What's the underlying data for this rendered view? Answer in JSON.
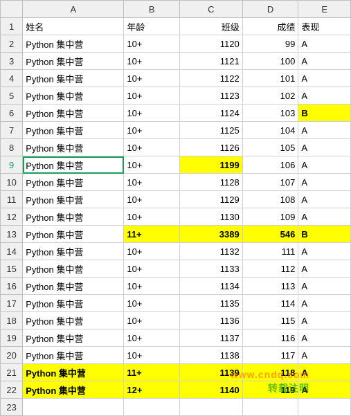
{
  "columns": {
    "rowhdr": "",
    "letters": [
      "A",
      "B",
      "C",
      "D",
      "E"
    ]
  },
  "header_row": {
    "num": "1",
    "cells": [
      "姓名",
      "年龄",
      "班级",
      "成绩",
      "表现"
    ]
  },
  "selected": {
    "row_index": 9,
    "col_index": 0
  },
  "rows": [
    {
      "num": "2",
      "a": "Python 集中营",
      "b": "10+",
      "c": "1120",
      "d": "99",
      "e": "A",
      "hl": {}
    },
    {
      "num": "3",
      "a": "Python 集中营",
      "b": "10+",
      "c": "1121",
      "d": "100",
      "e": "A",
      "hl": {}
    },
    {
      "num": "4",
      "a": "Python 集中营",
      "b": "10+",
      "c": "1122",
      "d": "101",
      "e": "A",
      "hl": {}
    },
    {
      "num": "5",
      "a": "Python 集中营",
      "b": "10+",
      "c": "1123",
      "d": "102",
      "e": "A",
      "hl": {}
    },
    {
      "num": "6",
      "a": "Python 集中营",
      "b": "10+",
      "c": "1124",
      "d": "103",
      "e": "B",
      "hl": {
        "e": true
      }
    },
    {
      "num": "7",
      "a": "Python 集中营",
      "b": "10+",
      "c": "1125",
      "d": "104",
      "e": "A",
      "hl": {}
    },
    {
      "num": "8",
      "a": "Python 集中营",
      "b": "10+",
      "c": "1126",
      "d": "105",
      "e": "A",
      "hl": {}
    },
    {
      "num": "9",
      "a": "Python 集中营",
      "b": "10+",
      "c": "1199",
      "d": "106",
      "e": "A",
      "hl": {
        "c": true
      }
    },
    {
      "num": "10",
      "a": "Python 集中营",
      "b": "10+",
      "c": "1128",
      "d": "107",
      "e": "A",
      "hl": {}
    },
    {
      "num": "11",
      "a": "Python 集中营",
      "b": "10+",
      "c": "1129",
      "d": "108",
      "e": "A",
      "hl": {}
    },
    {
      "num": "12",
      "a": "Python 集中营",
      "b": "10+",
      "c": "1130",
      "d": "109",
      "e": "A",
      "hl": {}
    },
    {
      "num": "13",
      "a": "Python 集中营",
      "b": "11+",
      "c": "3389",
      "d": "546",
      "e": "B",
      "hl": {
        "b": true,
        "c": true,
        "d": true,
        "e": true
      }
    },
    {
      "num": "14",
      "a": "Python 集中营",
      "b": "10+",
      "c": "1132",
      "d": "111",
      "e": "A",
      "hl": {}
    },
    {
      "num": "15",
      "a": "Python 集中营",
      "b": "10+",
      "c": "1133",
      "d": "112",
      "e": "A",
      "hl": {}
    },
    {
      "num": "16",
      "a": "Python 集中营",
      "b": "10+",
      "c": "1134",
      "d": "113",
      "e": "A",
      "hl": {}
    },
    {
      "num": "17",
      "a": "Python 集中营",
      "b": "10+",
      "c": "1135",
      "d": "114",
      "e": "A",
      "hl": {}
    },
    {
      "num": "18",
      "a": "Python 集中营",
      "b": "10+",
      "c": "1136",
      "d": "115",
      "e": "A",
      "hl": {}
    },
    {
      "num": "19",
      "a": "Python 集中营",
      "b": "10+",
      "c": "1137",
      "d": "116",
      "e": "A",
      "hl": {}
    },
    {
      "num": "20",
      "a": "Python 集中营",
      "b": "10+",
      "c": "1138",
      "d": "117",
      "e": "A",
      "hl": {}
    },
    {
      "num": "21",
      "a": "Python 集中营",
      "b": "11+",
      "c": "1139",
      "d": "118",
      "e": "A",
      "hl": {
        "a": true,
        "b": true,
        "c": true,
        "d": true,
        "e": true
      }
    },
    {
      "num": "22",
      "a": "Python 集中营",
      "b": "12+",
      "c": "1140",
      "d": "119",
      "e": "A",
      "hl": {
        "a": true,
        "b": true,
        "c": true,
        "d": true,
        "e": true
      }
    },
    {
      "num": "23",
      "a": "",
      "b": "",
      "c": "",
      "d": "",
      "e": "",
      "hl": {}
    }
  ],
  "watermark": {
    "line1": "www.cndq.com",
    "line2": "转载注明"
  },
  "col_widths": {
    "rowhdr": 32,
    "A": 145,
    "B": 80,
    "C": 90,
    "D": 80,
    "E": 75
  }
}
